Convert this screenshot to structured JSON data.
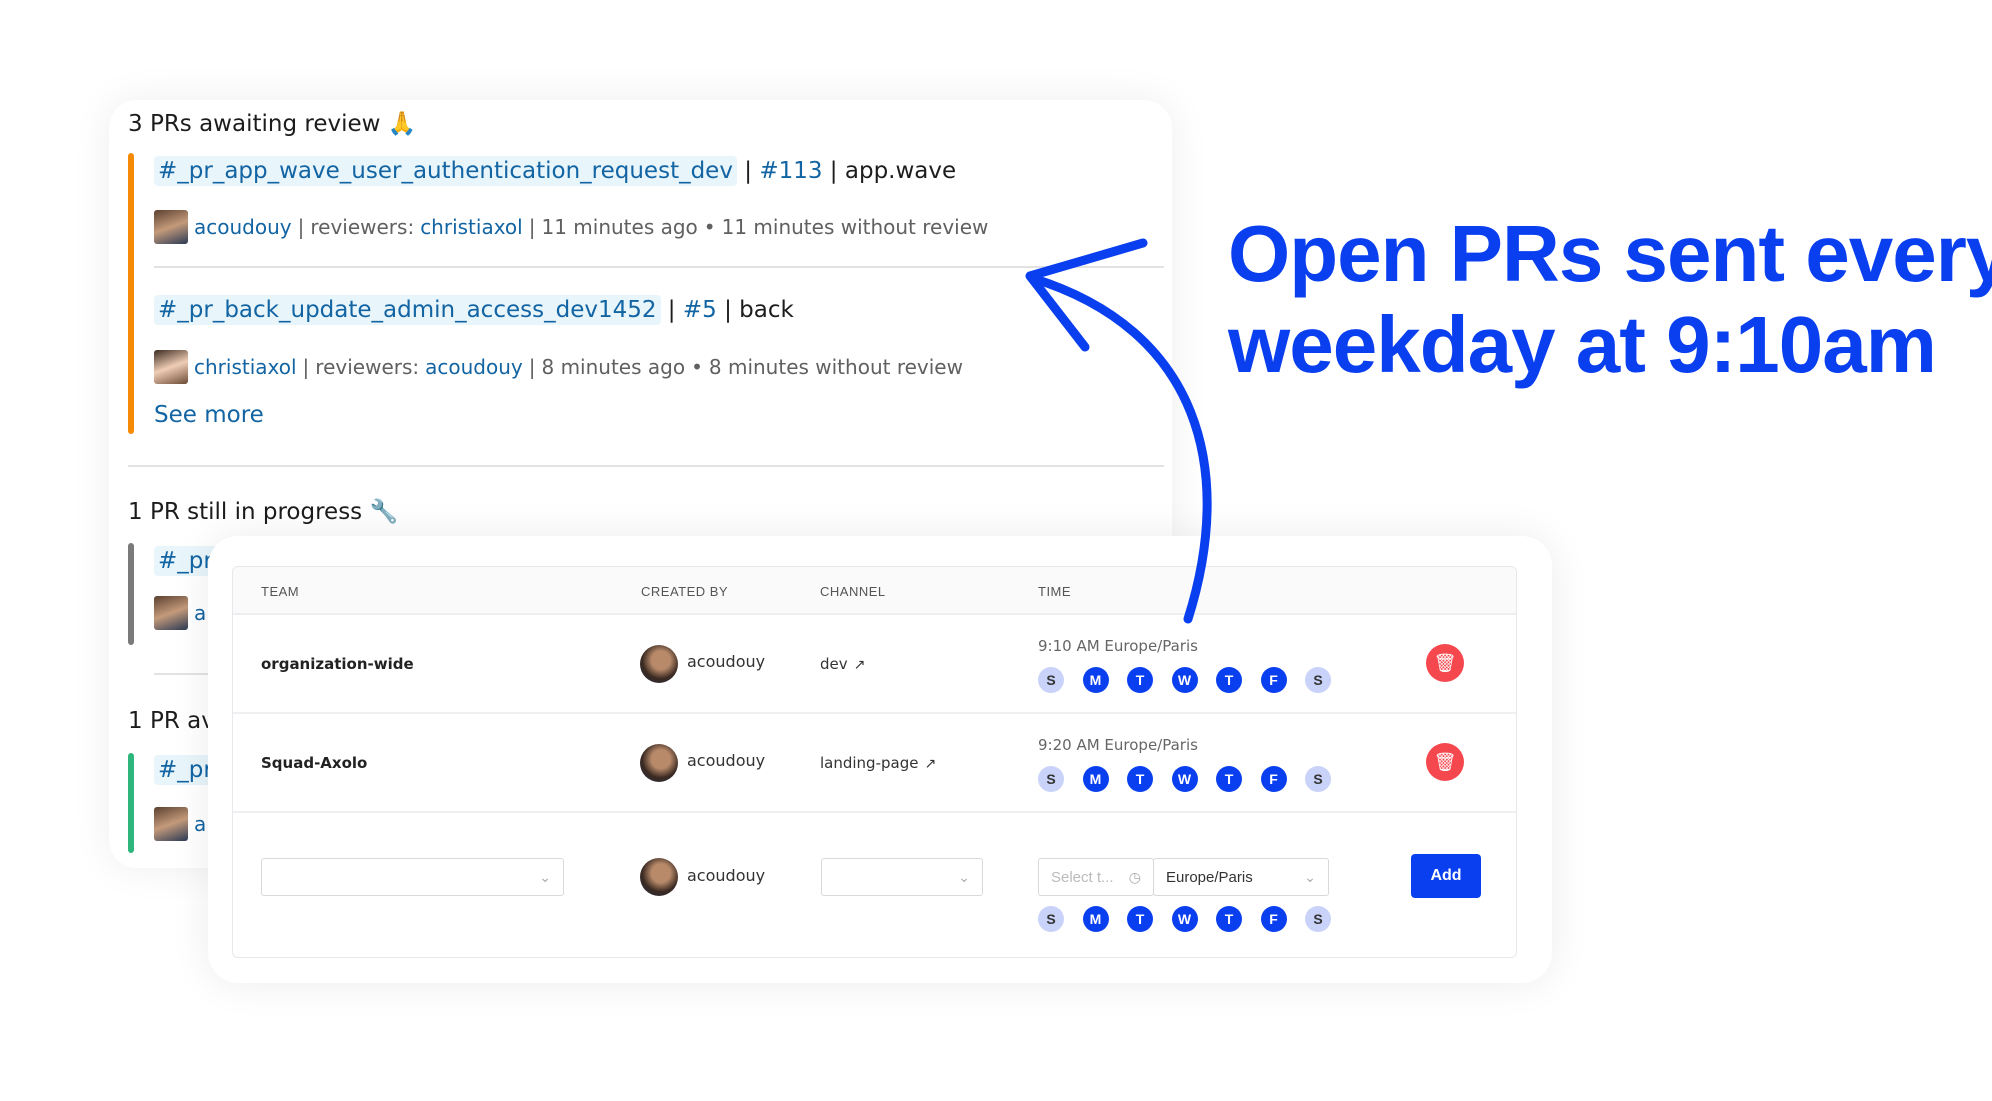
{
  "headline": {
    "line1": "Open PRs sent every",
    "line2": "weekday at 9:10am"
  },
  "colors": {
    "accent": "#0a3ff0",
    "awaiting": "#f58a07",
    "in_progress": "#7a7a7a",
    "approved": "#2eb67d",
    "delete": "#f5474e"
  },
  "slack": {
    "awaiting": {
      "title": "3 PRs awaiting review",
      "emoji": "🙏",
      "items": [
        {
          "channel": "#_pr_app_wave_user_authentication_request_dev",
          "number": "#113",
          "repo": "app.wave",
          "author": "acoudouy",
          "reviewers_label": "reviewers:",
          "reviewers": "christiaxol",
          "age": "11 minutes ago",
          "without_review": "11 minutes without review"
        },
        {
          "channel": "#_pr_back_update_admin_access_dev1452",
          "number": "#5",
          "repo": "back",
          "author": "christiaxol",
          "reviewers_label": "reviewers:",
          "reviewers": "acoudouy",
          "age": "8 minutes ago",
          "without_review": "8 minutes without review"
        }
      ],
      "see_more": "See more"
    },
    "in_progress": {
      "title": "1 PR still in progress",
      "emoji": "🔧",
      "channel_partial": "#_pr",
      "author_partial": "a"
    },
    "approved": {
      "title_partial": "1 PR av",
      "channel_partial": "#_pr",
      "author_partial": "a"
    }
  },
  "table": {
    "headers": {
      "team": "TEAM",
      "created_by": "CREATED BY",
      "channel": "CHANNEL",
      "time": "TIME"
    },
    "days": [
      "S",
      "M",
      "T",
      "W",
      "T",
      "F",
      "S"
    ],
    "rows": [
      {
        "team": "organization-wide",
        "created_by": "acoudouy",
        "channel": "dev",
        "time": "9:10 AM Europe/Paris",
        "days_active": [
          false,
          true,
          true,
          true,
          true,
          true,
          false
        ]
      },
      {
        "team": "Squad-Axolo",
        "created_by": "acoudouy",
        "channel": "landing-page",
        "time": "9:20 AM Europe/Paris",
        "days_active": [
          false,
          true,
          true,
          true,
          true,
          true,
          false
        ]
      }
    ],
    "new_row": {
      "team_value": "",
      "created_by": "acoudouy",
      "channel_value": "",
      "time_placeholder": "Select t...",
      "timezone": "Europe/Paris",
      "add_label": "Add",
      "days_active": [
        false,
        true,
        true,
        true,
        true,
        true,
        false
      ]
    }
  }
}
